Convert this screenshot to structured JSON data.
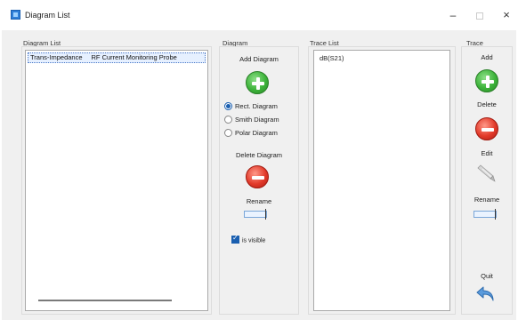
{
  "window": {
    "title": "Diagram List",
    "minimize": "–",
    "close": "×"
  },
  "diagram_list": {
    "label": "Diagram List",
    "rows": [
      {
        "col1": "Trans-Impedance",
        "col2": "RF Current Monitoring Probe"
      }
    ]
  },
  "diagram": {
    "label": "Diagram",
    "add_label": "Add Diagram",
    "radios": [
      {
        "label": "Rect. Diagram",
        "checked": true
      },
      {
        "label": "Smith Diagram",
        "checked": false
      },
      {
        "label": "Polar Diagram",
        "checked": false
      }
    ],
    "delete_label": "Delete Diagram",
    "rename_label": "Rename",
    "visible_label": "is visible"
  },
  "trace_list": {
    "label": "Trace List",
    "items": [
      "dB(S21)"
    ]
  },
  "trace": {
    "label": "Trace",
    "add_label": "Add",
    "delete_label": "Delete",
    "edit_label": "Edit",
    "rename_label": "Rename",
    "quit_label": "Quit"
  },
  "icons": {
    "add": "plus-circle-icon",
    "delete": "minus-circle-icon",
    "edit": "pencil-icon",
    "rename": "text-cursor-icon",
    "quit": "back-arrow-icon"
  },
  "colors": {
    "green": "#3db33a",
    "red": "#e23a2a",
    "accent": "#1a5fb0"
  }
}
